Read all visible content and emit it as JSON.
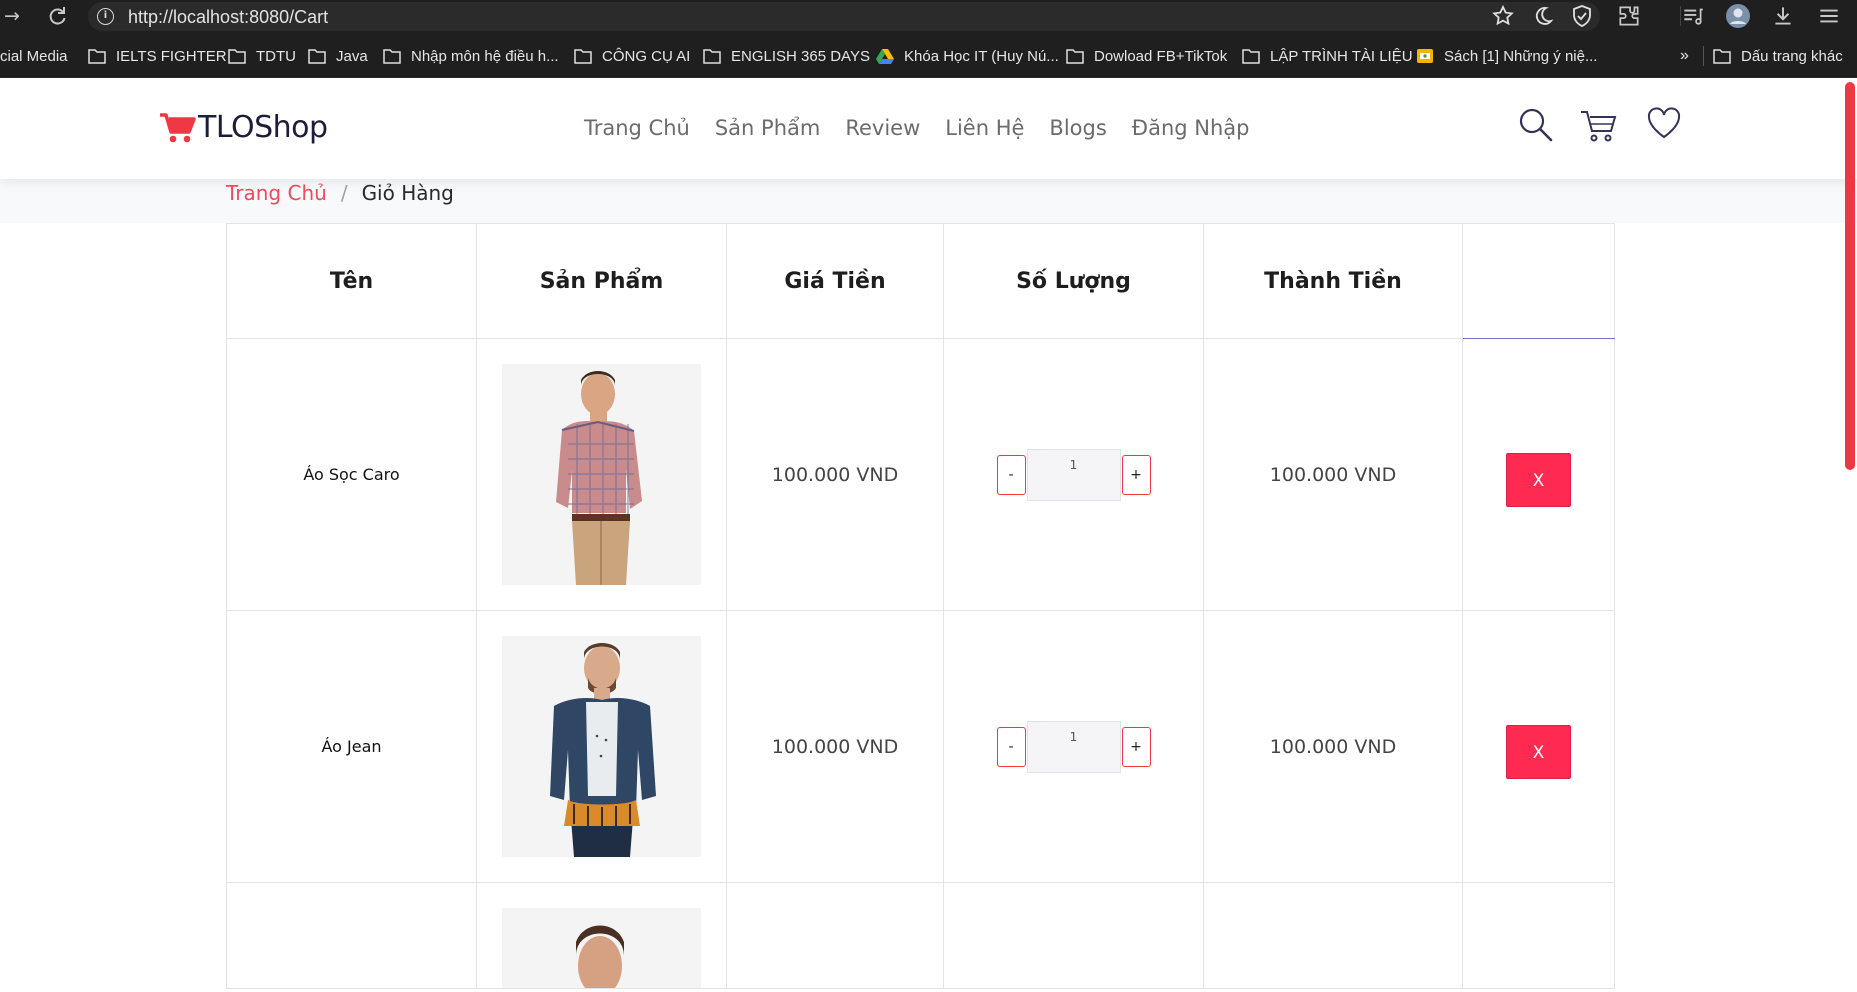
{
  "browser": {
    "url": "http://localhost:8080/Cart",
    "bookmarks": [
      {
        "label": "cial Media",
        "icon": "none"
      },
      {
        "label": "IELTS FIGHTER",
        "icon": "folder-icon"
      },
      {
        "label": "TDTU",
        "icon": "folder-icon"
      },
      {
        "label": "Java",
        "icon": "folder-icon"
      },
      {
        "label": "Nhập môn hệ điều h...",
        "icon": "folder-icon"
      },
      {
        "label": "CÔNG CỤ AI",
        "icon": "folder-icon"
      },
      {
        "label": "ENGLISH 365 DAYS",
        "icon": "folder-icon"
      },
      {
        "label": "Khóa Học IT (Huy Nú...",
        "icon": "drive-icon"
      },
      {
        "label": "Dowload FB+TikTok",
        "icon": "folder-icon"
      },
      {
        "label": "LẬP TRÌNH TÀI LIỆU",
        "icon": "folder-icon"
      },
      {
        "label": "Sách [1] Những ý niệ...",
        "icon": "slides-icon"
      }
    ],
    "overflow_label": "»",
    "other_bookmarks": "Dấu trang khác"
  },
  "site": {
    "brand": "TLOShop",
    "brand_color": "#ef3844",
    "menu": [
      "Trang Chủ",
      "Sản Phẩm",
      "Review",
      "Liên Hệ",
      "Blogs",
      "Đăng Nhập"
    ]
  },
  "breadcrumb": {
    "home": "Trang Chủ",
    "separator": "/",
    "current": "Giỏ Hàng"
  },
  "cart": {
    "headers": [
      "Tên",
      "Sản Phẩm",
      "Giá Tiền",
      "Số Lượng",
      "Thành Tiền",
      ""
    ],
    "decrement_label": "-",
    "increment_label": "+",
    "remove_label": "X",
    "rows": [
      {
        "name": "Áo Sọc Caro",
        "price": "100.000 VND",
        "quantity": "1",
        "total": "100.000 VND",
        "image": "plaid-shirt-model"
      },
      {
        "name": "Áo Jean",
        "price": "100.000 VND",
        "quantity": "1",
        "total": "100.000 VND",
        "image": "denim-jacket-model"
      }
    ]
  }
}
